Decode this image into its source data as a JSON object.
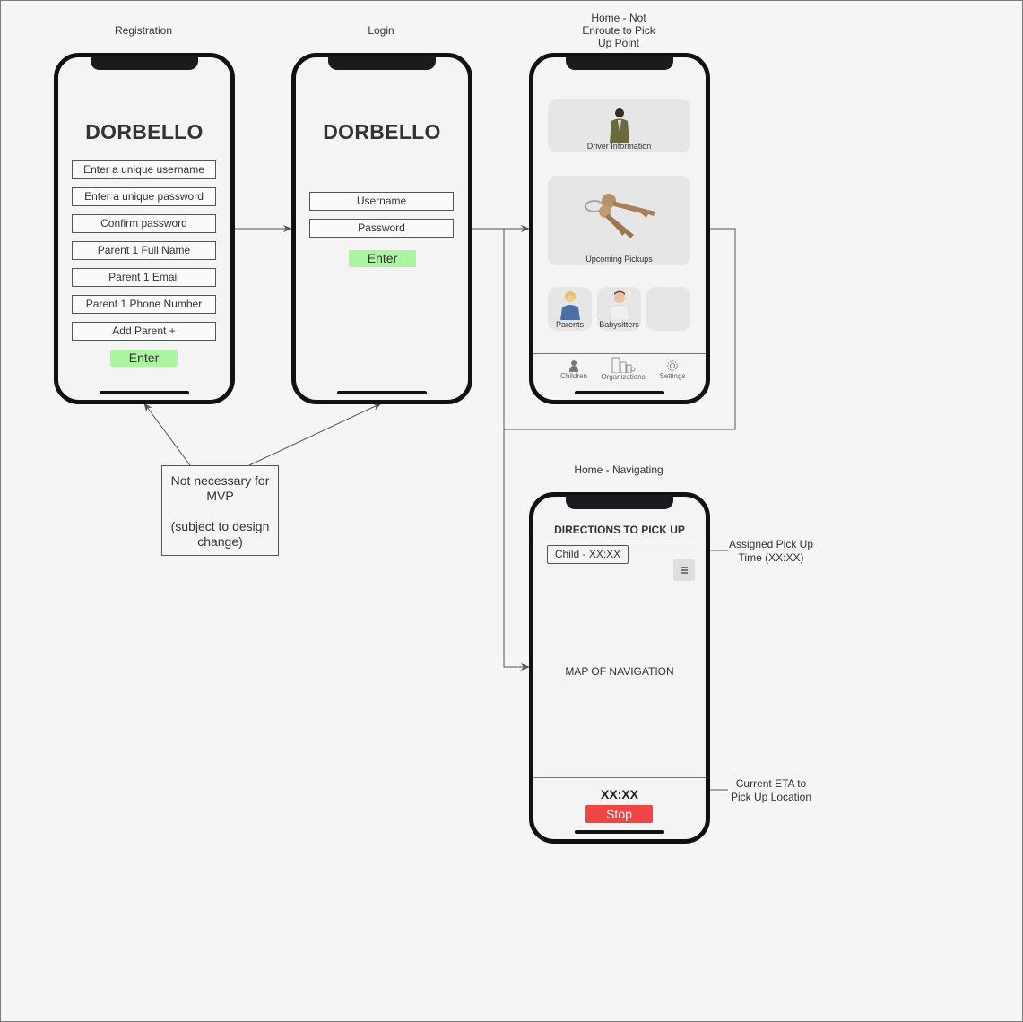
{
  "screens": {
    "registration": {
      "caption": "Registration",
      "logo": "DORBELLO",
      "fields": [
        "Enter a unique username",
        "Enter a unique password",
        "Confirm password",
        "Parent 1 Full Name",
        "Parent 1 Email",
        "Parent 1 Phone Number",
        "Add Parent +"
      ],
      "enter_label": "Enter"
    },
    "login": {
      "caption": "Login",
      "logo": "DORBELLO",
      "fields": [
        "Username",
        "Password"
      ],
      "enter_label": "Enter"
    },
    "home_not_enroute": {
      "caption_lines": [
        "Home - Not",
        "Enroute to Pick",
        "Up Point"
      ],
      "cards": {
        "driver": "Driver Information",
        "pickups": "Upcoming Pickups",
        "parents": "Parents",
        "babysitters": "Babysitters"
      },
      "nav": [
        "Children",
        "Organizations",
        "Settings"
      ]
    },
    "home_navigating": {
      "caption": "Home - Navigating",
      "header": "DIRECTIONS TO PICK UP",
      "child_time": "Child - XX:XX",
      "map_label": "MAP OF NAVIGATION",
      "eta": "XX:XX",
      "stop_label": "Stop"
    }
  },
  "notes": {
    "mvp": [
      "Not necessary for",
      "MVP",
      "",
      "(subject to design",
      "change)"
    ],
    "assigned_time": [
      "Assigned Pick Up",
      "Time (XX:XX)"
    ],
    "current_eta": [
      "Current ETA to",
      "Pick Up Location"
    ]
  },
  "colors": {
    "enter_button": "#aaf5a0",
    "stop_button": "#f04545",
    "phone_frame": "#111111"
  }
}
